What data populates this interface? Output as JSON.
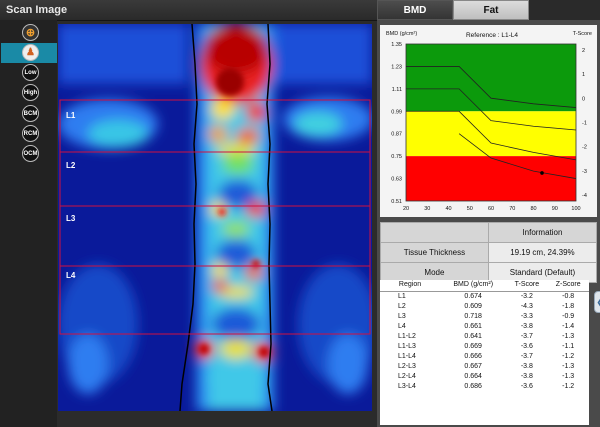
{
  "left": {
    "title": "Scan Image"
  },
  "tools": [
    {
      "name": "crosshair-tool",
      "label": ""
    },
    {
      "name": "body-tool",
      "label": ""
    },
    {
      "name": "low-button",
      "label": "Low"
    },
    {
      "name": "high-button",
      "label": "High"
    },
    {
      "name": "bcm-button",
      "label": "BCM"
    },
    {
      "name": "rcm-button",
      "label": "RCM"
    },
    {
      "name": "ocm-button",
      "label": "OCM"
    }
  ],
  "regions": [
    "L1",
    "L2",
    "L3",
    "L4"
  ],
  "tabs": {
    "bmd": "BMD",
    "fat": "Fat"
  },
  "chart_data": {
    "type": "line",
    "title": "Reference : L1-L4",
    "ylabel_left": "BMD (g/cm²)",
    "ylabel_right": "T-Score",
    "x_ticks": [
      20,
      30,
      40,
      50,
      60,
      70,
      80,
      90,
      100
    ],
    "y_ticks_left": [
      1.35,
      1.23,
      1.11,
      0.99,
      0.87,
      0.75,
      0.63,
      0.51
    ],
    "y_ticks_right": [
      2,
      1,
      0,
      -1,
      -2,
      -3,
      -4
    ],
    "xlim": [
      20,
      100
    ],
    "ylim": [
      0.51,
      1.35
    ],
    "bands": [
      {
        "name": "normal",
        "from": 0.99,
        "to": 1.35,
        "color": "#0c9a0c"
      },
      {
        "name": "osteopenia",
        "from": 0.75,
        "to": 0.99,
        "color": "#ffff00"
      },
      {
        "name": "osteoporosis",
        "from": 0.51,
        "to": 0.75,
        "color": "#ff0000"
      }
    ],
    "series": [
      {
        "x": [
          20,
          45,
          60,
          80,
          100
        ],
        "y": [
          1.23,
          1.23,
          1.06,
          1.03,
          1.01
        ]
      },
      {
        "x": [
          20,
          45,
          60,
          80,
          100
        ],
        "y": [
          1.11,
          1.11,
          0.94,
          0.91,
          0.89
        ]
      },
      {
        "x": [
          20,
          45,
          60,
          80,
          100
        ],
        "y": [
          0.99,
          0.99,
          0.82,
          0.77,
          0.73
        ]
      },
      {
        "x": [
          45,
          60,
          80,
          100
        ],
        "y": [
          0.87,
          0.74,
          0.67,
          0.63
        ]
      }
    ],
    "marker": {
      "x": 84,
      "y": 0.66
    }
  },
  "info": {
    "header": "Information",
    "rows": [
      {
        "label": "Tissue Thickness",
        "value": "19.19 cm, 24.39%"
      },
      {
        "label": "Mode",
        "value": "Standard (Default)"
      }
    ]
  },
  "results": {
    "columns": [
      "Region",
      "BMD (g/cm²)",
      "T-Score",
      "Z-Score"
    ],
    "rows": [
      [
        "L1",
        "0.674",
        "-3.2",
        "-0.8"
      ],
      [
        "L2",
        "0.609",
        "-4.3",
        "-1.8"
      ],
      [
        "L3",
        "0.718",
        "-3.3",
        "-0.9"
      ],
      [
        "L4",
        "0.661",
        "-3.8",
        "-1.4"
      ],
      [
        "L1-L2",
        "0.641",
        "-3.7",
        "-1.3"
      ],
      [
        "L1-L3",
        "0.669",
        "-3.6",
        "-1.1"
      ],
      [
        "L1-L4",
        "0.666",
        "-3.7",
        "-1.2"
      ],
      [
        "L2-L3",
        "0.667",
        "-3.8",
        "-1.3"
      ],
      [
        "L2-L4",
        "0.664",
        "-3.8",
        "-1.3"
      ],
      [
        "L3-L4",
        "0.686",
        "-3.6",
        "-1.2"
      ]
    ]
  }
}
